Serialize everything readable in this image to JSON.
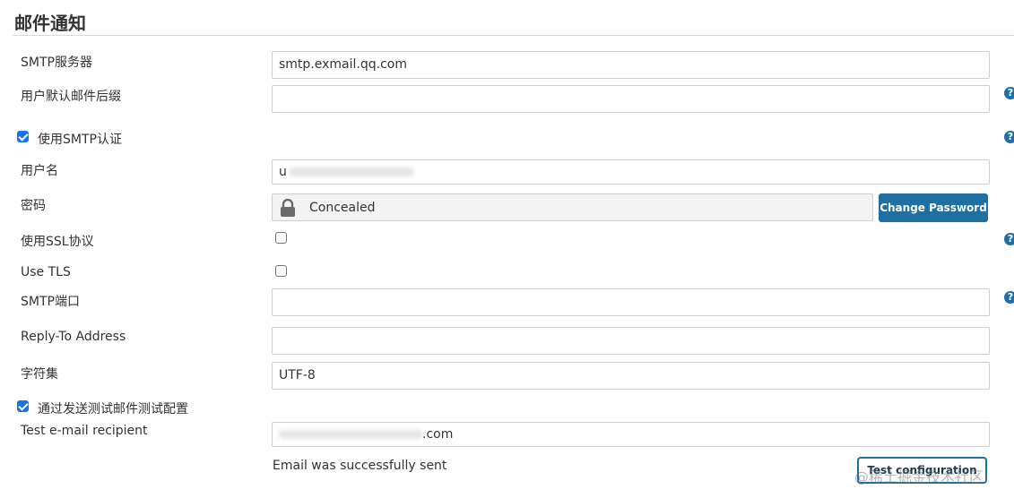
{
  "section": {
    "title": "邮件通知"
  },
  "fields": {
    "smtp_server": {
      "label": "SMTP服务器",
      "value": "smtp.exmail.qq.com"
    },
    "default_suffix": {
      "label": "用户默认邮件后缀",
      "value": ""
    },
    "use_smtp_auth": {
      "label": "使用SMTP认证",
      "checked": true
    },
    "username": {
      "label": "用户名",
      "value": "u"
    },
    "password": {
      "label": "密码",
      "value": "Concealed",
      "button": "Change Password"
    },
    "use_ssl": {
      "label": "使用SSL协议",
      "checked": false
    },
    "use_tls": {
      "label": "Use TLS",
      "checked": false
    },
    "smtp_port": {
      "label": "SMTP端口",
      "value": ""
    },
    "reply_to": {
      "label": "Reply-To Address",
      "value": ""
    },
    "charset": {
      "label": "字符集",
      "value": "UTF-8"
    },
    "test_by_sending": {
      "label": "通过发送测试邮件测试配置",
      "checked": true
    },
    "test_recipient": {
      "label": "Test e-mail recipient",
      "value_suffix": ".com"
    }
  },
  "status": {
    "message": "Email was successfully sent"
  },
  "buttons": {
    "test_configuration": "Test configuration"
  },
  "help": {
    "glyph": "?"
  },
  "watermark": "@稀土掘金技术社区",
  "colors": {
    "accent": "#1f6fa1",
    "checkbox": "#1a73e8",
    "help": "#1e6fa8"
  }
}
